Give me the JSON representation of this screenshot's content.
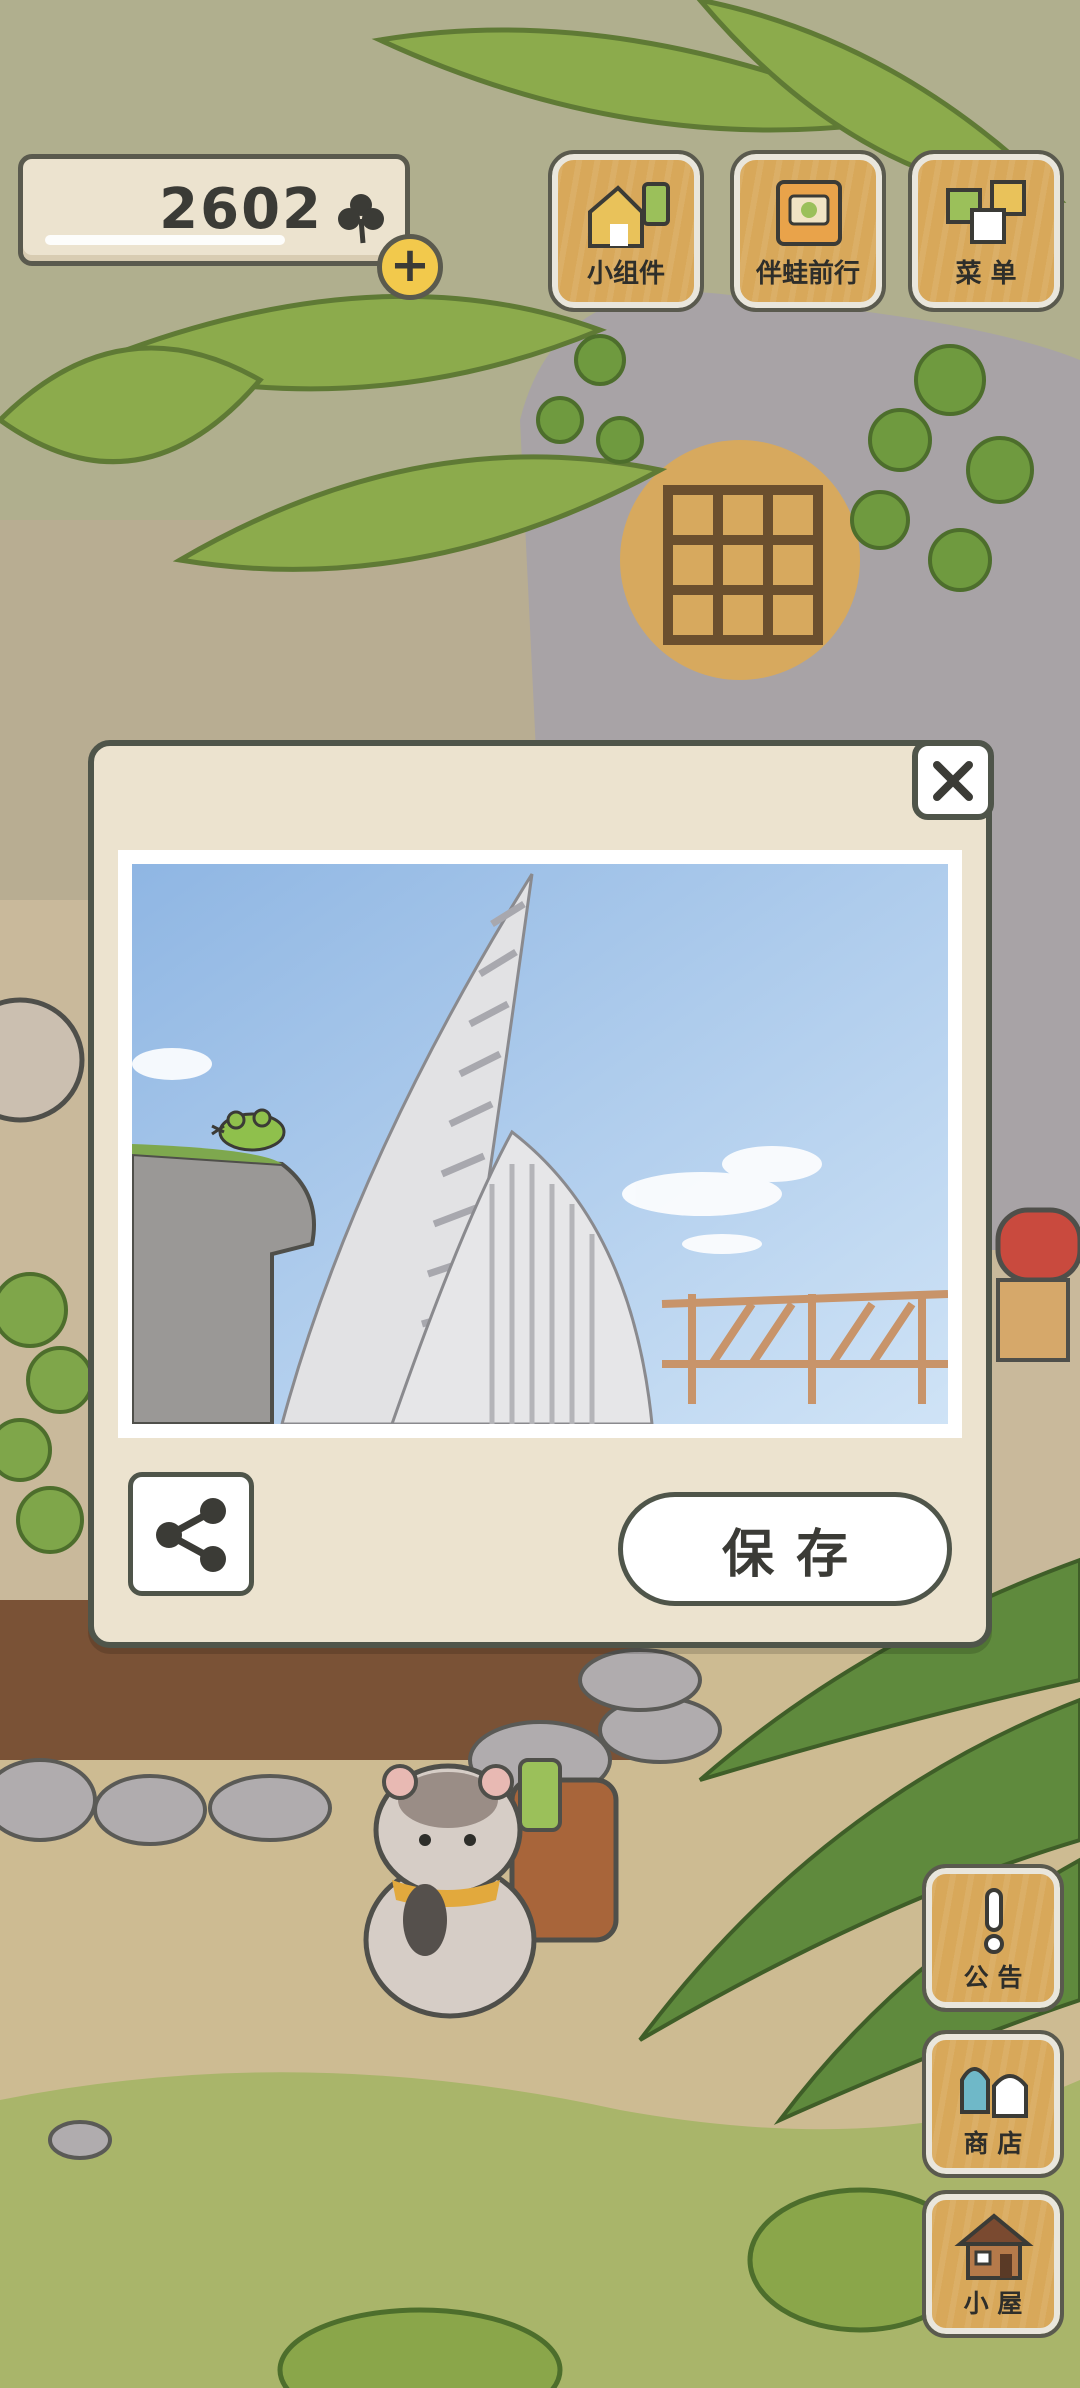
{
  "currency": {
    "value": "2602",
    "icon": "clover-icon"
  },
  "top_menu": {
    "widget_label": "小组件",
    "travel_label": "伴蛙前行",
    "menu_label": "菜 单"
  },
  "side_menu": {
    "notice_label": "公 告",
    "shop_label": "商 店",
    "house_label": "小 屋"
  },
  "photo_dialog": {
    "save_label": "保存"
  },
  "colors": {
    "button_wood": "#d8a85a",
    "panel_cream": "#ece3cf",
    "outline": "#4f554a"
  }
}
